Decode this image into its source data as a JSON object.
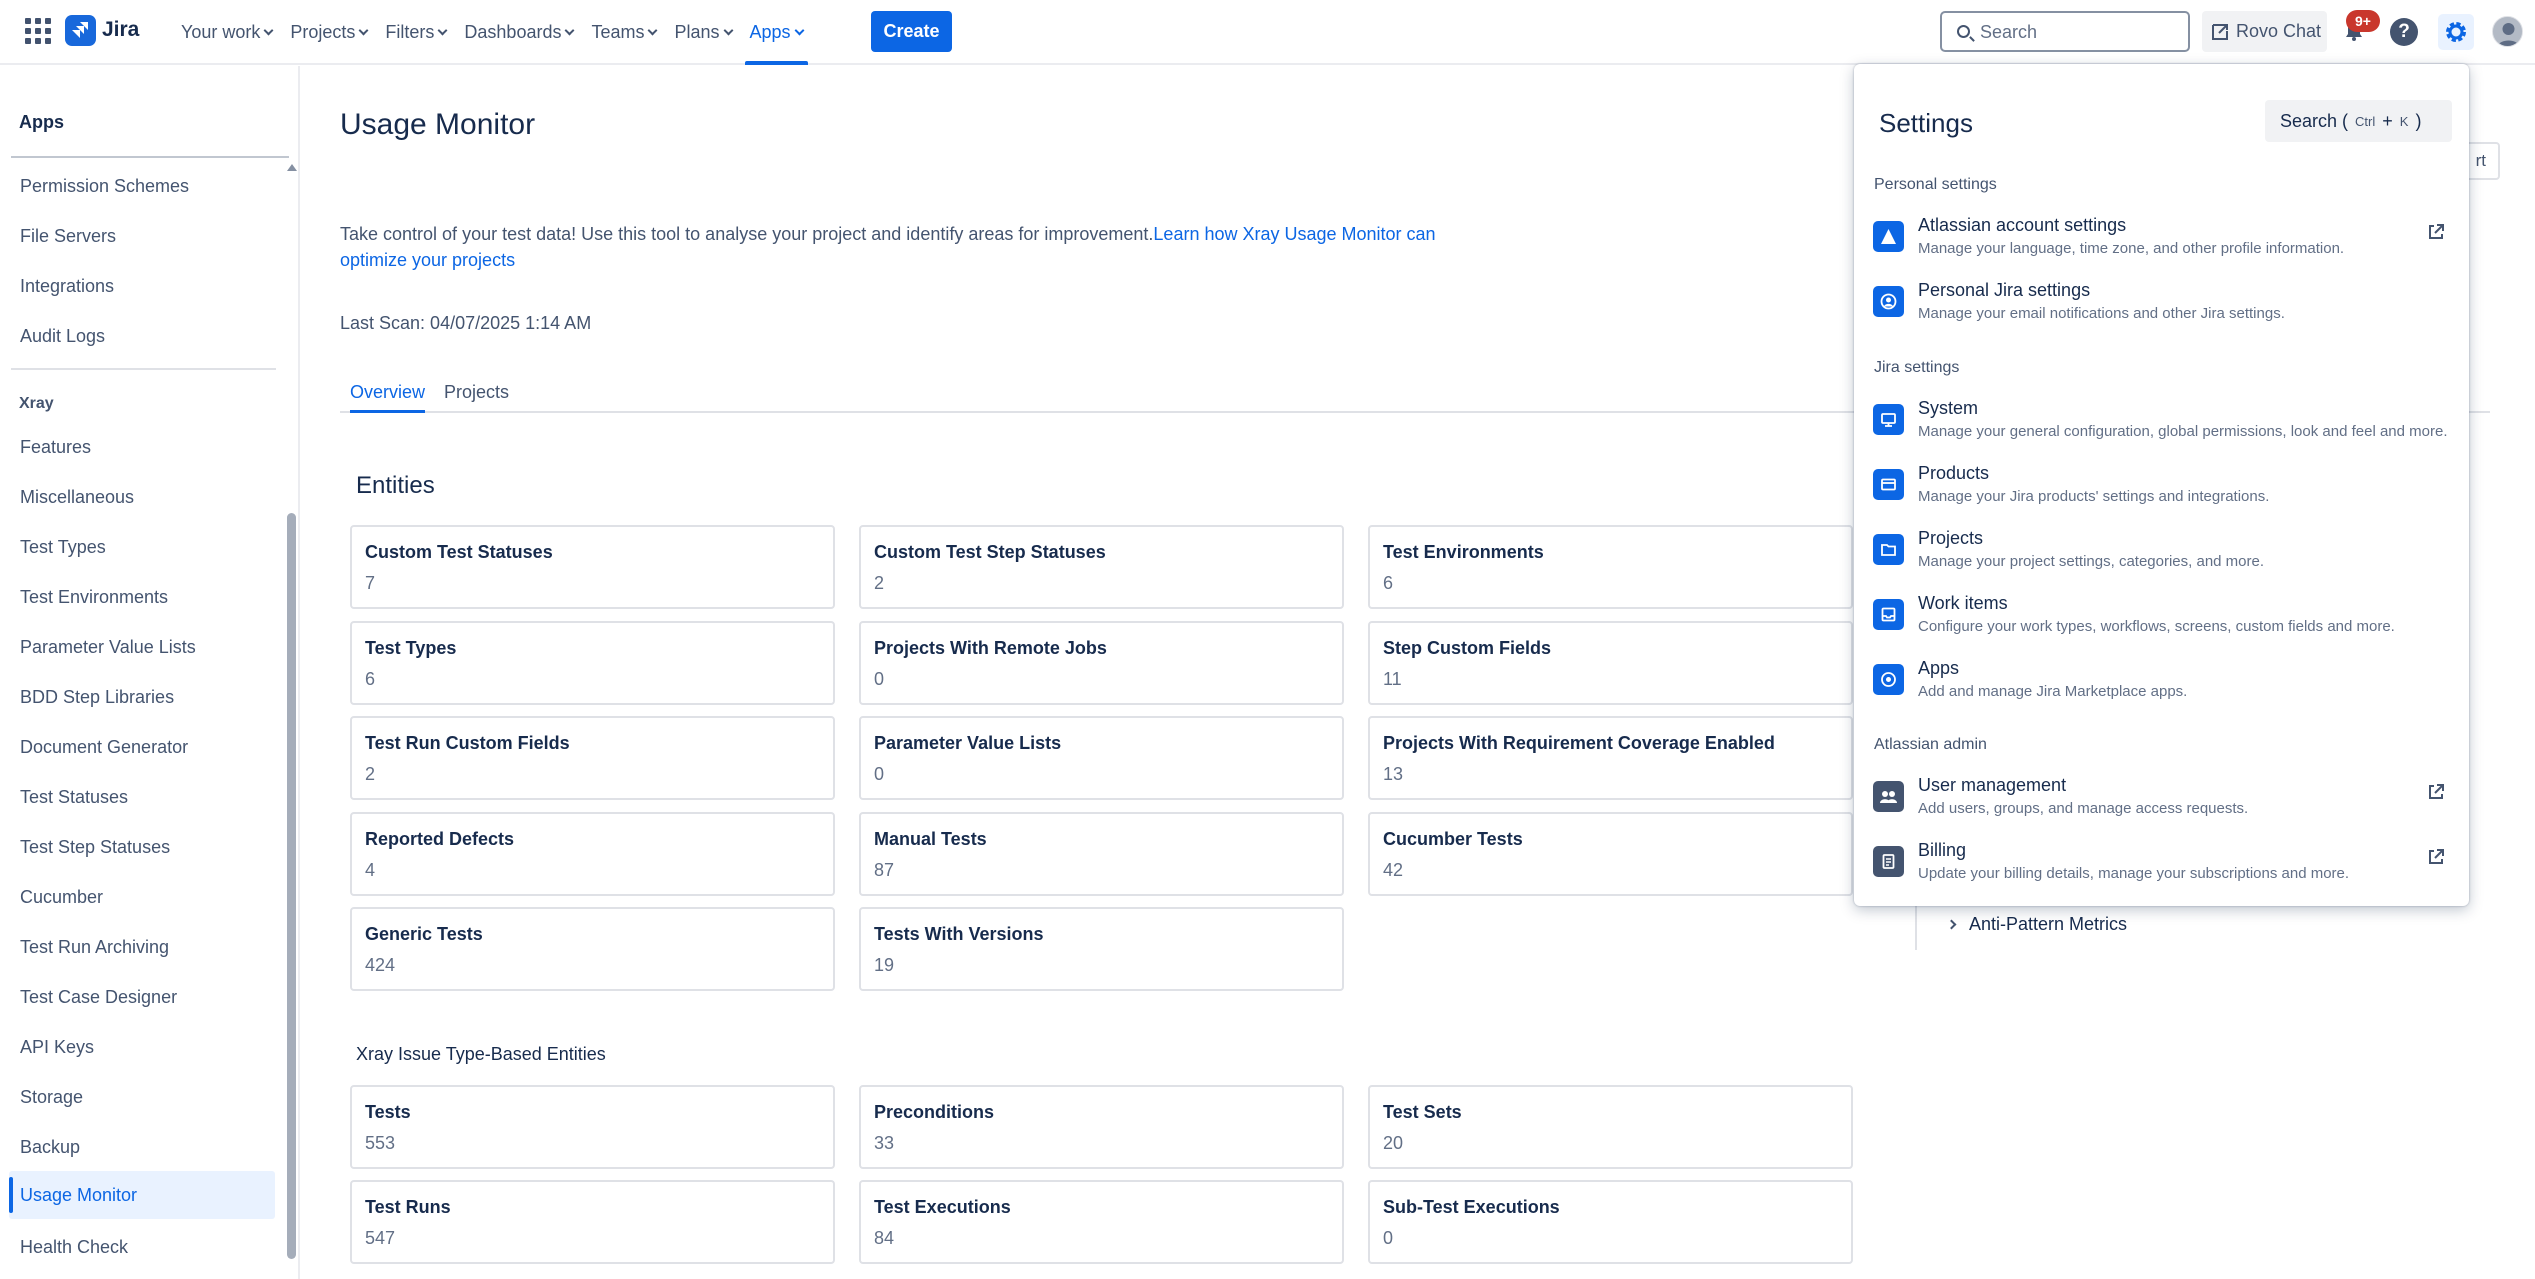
{
  "nav": {
    "logo_text": "Jira",
    "items": [
      {
        "label": "Your work"
      },
      {
        "label": "Projects"
      },
      {
        "label": "Filters"
      },
      {
        "label": "Dashboards"
      },
      {
        "label": "Teams"
      },
      {
        "label": "Plans"
      },
      {
        "label": "Apps",
        "active": true
      }
    ],
    "create_label": "Create",
    "search_placeholder": "Search",
    "rovo_label": "Rovo Chat",
    "notification_badge": "9+",
    "help_label": "?"
  },
  "sidebar": {
    "header": "Apps",
    "top_items": [
      "Permission Schemes",
      "File Servers",
      "Integrations",
      "Audit Logs"
    ],
    "group_label": "Xray",
    "xray_items": [
      "Features",
      "Miscellaneous",
      "Test Types",
      "Test Environments",
      "Parameter Value Lists",
      "BDD Step Libraries",
      "Document Generator",
      "Test Statuses",
      "Test Step Statuses",
      "Cucumber",
      "Test Run Archiving",
      "Test Case Designer",
      "API Keys",
      "Storage",
      "Backup",
      "Usage Monitor",
      "Health Check"
    ],
    "active_item": "Usage Monitor"
  },
  "main": {
    "title": "Usage Monitor",
    "description_text": "Take control of your test data! Use this tool to analyse your project and identify areas for improvement.",
    "description_link": "Learn how Xray Usage Monitor can optimize your projects",
    "last_scan": "Last Scan: 04/07/2025 1:14 AM",
    "tabs": [
      {
        "label": "Overview",
        "active": true
      },
      {
        "label": "Projects"
      }
    ],
    "entities_title": "Entities",
    "entities": [
      {
        "label": "Custom Test Statuses",
        "value": "7"
      },
      {
        "label": "Custom Test Step Statuses",
        "value": "2"
      },
      {
        "label": "Test Environments",
        "value": "6"
      },
      {
        "label": "Test Types",
        "value": "6"
      },
      {
        "label": "Projects With Remote Jobs",
        "value": "0"
      },
      {
        "label": "Step Custom Fields",
        "value": "11"
      },
      {
        "label": "Test Run Custom Fields",
        "value": "2"
      },
      {
        "label": "Parameter Value Lists",
        "value": "0"
      },
      {
        "label": "Projects With Requirement Coverage Enabled",
        "value": "13"
      },
      {
        "label": "Reported Defects",
        "value": "4"
      },
      {
        "label": "Manual Tests",
        "value": "87"
      },
      {
        "label": "Cucumber Tests",
        "value": "42"
      },
      {
        "label": "Generic Tests",
        "value": "424"
      },
      {
        "label": "Tests With Versions",
        "value": "19"
      }
    ],
    "issue_entities_title": "Xray Issue Type-Based Entities",
    "issue_entities": [
      {
        "label": "Tests",
        "value": "553"
      },
      {
        "label": "Preconditions",
        "value": "33"
      },
      {
        "label": "Test Sets",
        "value": "20"
      },
      {
        "label": "Test Runs",
        "value": "547"
      },
      {
        "label": "Test Executions",
        "value": "84"
      },
      {
        "label": "Sub-Test Executions",
        "value": "0"
      }
    ],
    "partial_button": "rt",
    "anti_pattern": "Anti-Pattern Metrics"
  },
  "settings": {
    "title": "Settings",
    "search_label": "Search (",
    "search_key1": "Ctrl",
    "search_plus": "+",
    "search_key2": "K",
    "search_close": ")",
    "personal_label": "Personal settings",
    "personal": [
      {
        "name": "Atlassian account settings",
        "desc": "Manage your language, time zone, and other profile information.",
        "icon": "atlassian-icon",
        "external": true
      },
      {
        "name": "Personal Jira settings",
        "desc": "Manage your email notifications and other Jira settings.",
        "icon": "person-icon",
        "external": false
      }
    ],
    "jira_label": "Jira settings",
    "jira": [
      {
        "name": "System",
        "desc": "Manage your general configuration, global permissions, look and feel and more.",
        "icon": "monitor-icon"
      },
      {
        "name": "Products",
        "desc": "Manage your Jira products' settings and integrations.",
        "icon": "card-icon"
      },
      {
        "name": "Projects",
        "desc": "Manage your project settings, categories, and more.",
        "icon": "folder-icon"
      },
      {
        "name": "Work items",
        "desc": "Configure your work types, workflows, screens, custom fields and more.",
        "icon": "tray-icon"
      },
      {
        "name": "Apps",
        "desc": "Add and manage Jira Marketplace apps.",
        "icon": "apps-circle-icon"
      }
    ],
    "admin_label": "Atlassian admin",
    "admin": [
      {
        "name": "User management",
        "desc": "Add users, groups, and manage access requests.",
        "icon": "people-icon",
        "external": true
      },
      {
        "name": "Billing",
        "desc": "Update your billing details, manage your subscriptions and more.",
        "icon": "document-icon",
        "external": true
      }
    ]
  },
  "colors": {
    "brand": "#1868db",
    "accent": "#0c66e4",
    "badge": "#c9372c",
    "text": "#172b4d",
    "subtle_text": "#626f86"
  }
}
